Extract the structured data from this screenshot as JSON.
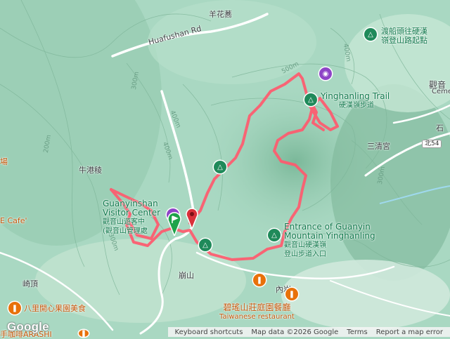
{
  "map": {
    "colors": {
      "terrain": "#a9d8c2",
      "forest": "#8fc8aa",
      "route": "#ff5a6e",
      "road": "#ffffff",
      "river": "#9fd9ee"
    },
    "labels": {
      "huafushan_rd": "Huafushan Rd",
      "yanghuazhai": "羊花蕎",
      "niugangleng": "牛港稜",
      "chang": "場",
      "cafe": "E Cafe'",
      "ding": "崎頂",
      "bajiali": "八里開心果園美食",
      "arashi": "手咖啡ARASHI",
      "sanqinggong": "三清宮",
      "beiwu4": "北54",
      "shi": "石",
      "cem_zh": "觀音",
      "cem_en": "Ceme",
      "bengshan": "崩山",
      "neiyan": "內岩"
    },
    "pois": {
      "ferry_trail": [
        "渡船頭往硬漢",
        "嶺登山路起點"
      ],
      "yinghanling_trail": [
        "Yinghanling Trail",
        "硬漢嶺步道"
      ],
      "visitor_center": [
        "Guanyinshan",
        "Visitor Center",
        "觀音山遊客中",
        "(觀音山管理處"
      ],
      "entrance": [
        "Entrance of Guanyin",
        "Mountain Yinghanling",
        "觀音山硬漢嶺",
        "登山步道入口"
      ],
      "restaurant": [
        "碧瑤山莊庭園餐廳",
        "Taiwanese restaurant"
      ]
    },
    "contours": [
      "500m",
      "400m",
      "300m",
      "200m",
      "400m",
      "400m",
      "300m",
      "300m"
    ],
    "icons": [
      "trail-icon",
      "camera-icon",
      "visitor-center-icon",
      "restaurant-icon",
      "start-flag-icon",
      "end-marker-icon"
    ]
  },
  "footer": {
    "logo": "Google",
    "shortcuts": "Keyboard shortcuts",
    "mapdata": "Map data ©2026 Google",
    "terms": "Terms",
    "report": "Report a map error"
  }
}
